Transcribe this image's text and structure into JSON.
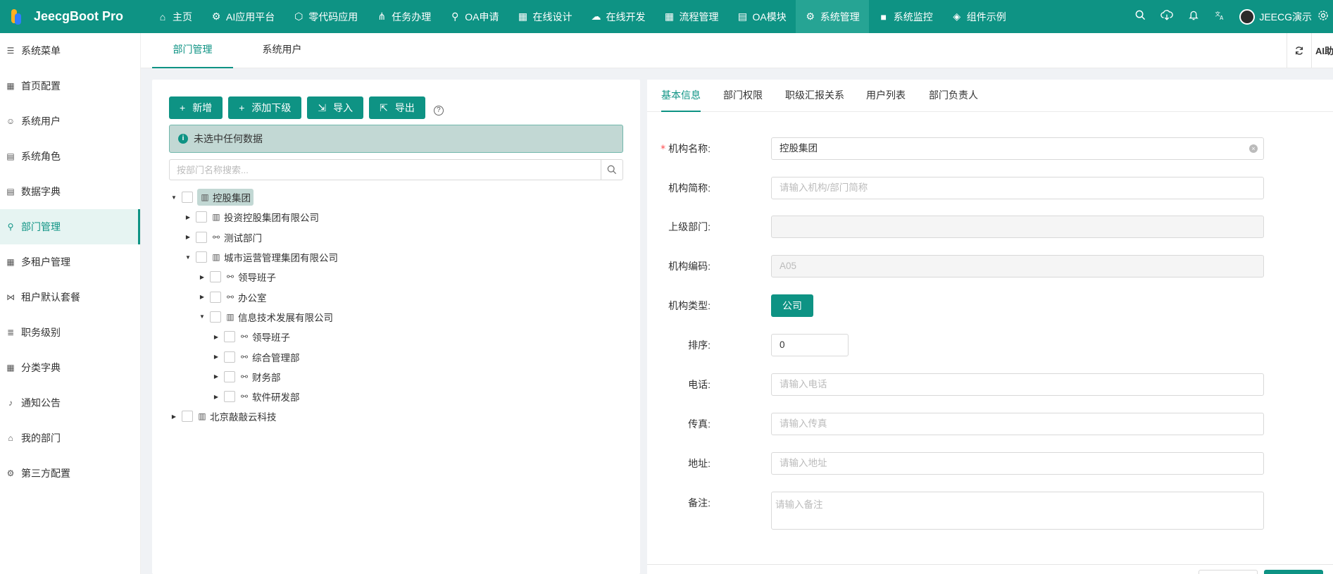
{
  "brand": {
    "name": "JeecgBoot Pro"
  },
  "topnav": [
    {
      "icon": "⌂",
      "label": "主页"
    },
    {
      "icon": "⚙",
      "label": "AI应用平台"
    },
    {
      "icon": "⬡",
      "label": "零代码应用"
    },
    {
      "icon": "⋔",
      "label": "任务办理"
    },
    {
      "icon": "⚲",
      "label": "OA申请"
    },
    {
      "icon": "▦",
      "label": "在线设计"
    },
    {
      "icon": "☁",
      "label": "在线开发"
    },
    {
      "icon": "▦",
      "label": "流程管理"
    },
    {
      "icon": "▤",
      "label": "OA模块"
    },
    {
      "icon": "⚙",
      "label": "系统管理"
    },
    {
      "icon": "■",
      "label": "系统监控"
    },
    {
      "icon": "◈",
      "label": "组件示例"
    }
  ],
  "toolbar": {
    "user_name": "JEECG演示"
  },
  "sidebar": [
    {
      "icon": "☰",
      "label": "系统菜单"
    },
    {
      "icon": "▦",
      "label": "首页配置"
    },
    {
      "icon": "☺",
      "label": "系统用户"
    },
    {
      "icon": "▤",
      "label": "系统角色"
    },
    {
      "icon": "▤",
      "label": "数据字典"
    },
    {
      "icon": "⚲",
      "label": "部门管理"
    },
    {
      "icon": "▦",
      "label": "多租户管理"
    },
    {
      "icon": "⋈",
      "label": "租户默认套餐"
    },
    {
      "icon": "≣",
      "label": "职务级别"
    },
    {
      "icon": "▦",
      "label": "分类字典"
    },
    {
      "icon": "♪",
      "label": "通知公告"
    },
    {
      "icon": "⌂",
      "label": "我的部门"
    },
    {
      "icon": "⚙",
      "label": "第三方配置"
    }
  ],
  "page_tabs": [
    {
      "label": "部门管理"
    },
    {
      "label": "系统用户"
    }
  ],
  "tab_tools": {
    "ai_label": "AI助"
  },
  "left": {
    "buttons": [
      {
        "icon": "+",
        "label": "新增"
      },
      {
        "icon": "+",
        "label": "添加下级"
      },
      {
        "icon": "⇲",
        "label": "导入"
      },
      {
        "icon": "⇱",
        "label": "导出"
      }
    ],
    "help": "?",
    "alert_text": "未选中任何数据",
    "search_placeholder": "按部门名称搜索..."
  },
  "tree": [
    {
      "label": "控股集团",
      "level": 0,
      "expanded": true,
      "type": "company",
      "selected": true
    },
    {
      "label": "投资控股集团有限公司",
      "level": 1,
      "expanded": false,
      "type": "company"
    },
    {
      "label": "测试部门",
      "level": 1,
      "expanded": false,
      "type": "dept"
    },
    {
      "label": "城市运营管理集团有限公司",
      "level": 1,
      "expanded": true,
      "type": "company"
    },
    {
      "label": "领导班子",
      "level": 2,
      "expanded": false,
      "type": "dept"
    },
    {
      "label": "办公室",
      "level": 2,
      "expanded": false,
      "type": "dept"
    },
    {
      "label": "信息技术发展有限公司",
      "level": 2,
      "expanded": true,
      "type": "company"
    },
    {
      "label": "领导班子",
      "level": 3,
      "expanded": false,
      "type": "dept"
    },
    {
      "label": "综合管理部",
      "level": 3,
      "expanded": false,
      "type": "dept"
    },
    {
      "label": "财务部",
      "level": 3,
      "expanded": false,
      "type": "dept"
    },
    {
      "label": "软件研发部",
      "level": 3,
      "expanded": false,
      "type": "dept"
    },
    {
      "label": "北京敲敲云科技",
      "level": 0,
      "expanded": false,
      "type": "company"
    }
  ],
  "right_tabs": [
    {
      "label": "基本信息"
    },
    {
      "label": "部门权限"
    },
    {
      "label": "职级汇报关系"
    },
    {
      "label": "用户列表"
    },
    {
      "label": "部门负责人"
    }
  ],
  "form": {
    "name_label": "机构名称:",
    "name_value": "控股集团",
    "short_label": "机构简称:",
    "short_placeholder": "请输入机构/部门简称",
    "parent_label": "上级部门:",
    "parent_value": "",
    "code_label": "机构编码:",
    "code_value": "A05",
    "type_label": "机构类型:",
    "type_value": "公司",
    "order_label": "排序:",
    "order_value": "0",
    "phone_label": "电话:",
    "phone_placeholder": "请输入电话",
    "fax_label": "传真:",
    "fax_placeholder": "请输入传真",
    "address_label": "地址:",
    "address_placeholder": "请输入地址",
    "remark_label": "备注:",
    "remark_placeholder": "请输入备注"
  },
  "colors": {
    "primary": "#0e9384",
    "nav_active": "#26a494",
    "selected_bg": "#c2d8d4"
  }
}
